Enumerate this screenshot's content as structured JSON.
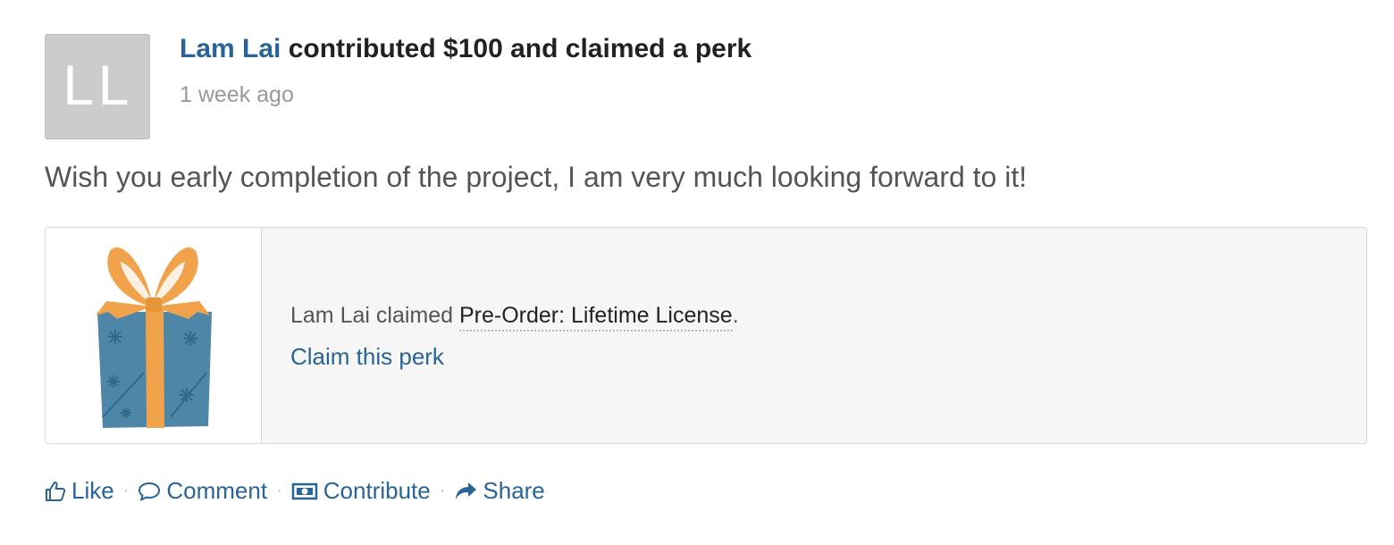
{
  "post": {
    "avatar_initials": "LL",
    "author": "Lam Lai",
    "action_text": " contributed $100 and claimed a perk",
    "time": "1 week ago",
    "message": "Wish you early completion of the project, I am very much looking forward to it!"
  },
  "perk": {
    "icon": "gift-icon",
    "claimer": "Lam Lai",
    "claimed_word": " claimed ",
    "name": "Pre-Order: Lifetime License",
    "period": ".",
    "claim_label": "Claim this perk"
  },
  "actions": {
    "like": "Like",
    "comment": "Comment",
    "contribute": "Contribute",
    "share": "Share",
    "separator": "·"
  },
  "colors": {
    "link": "#2a6496",
    "gift_box": "#4e86a8",
    "gift_ribbon": "#f0a34a",
    "avatar_bg": "#cccccc"
  }
}
